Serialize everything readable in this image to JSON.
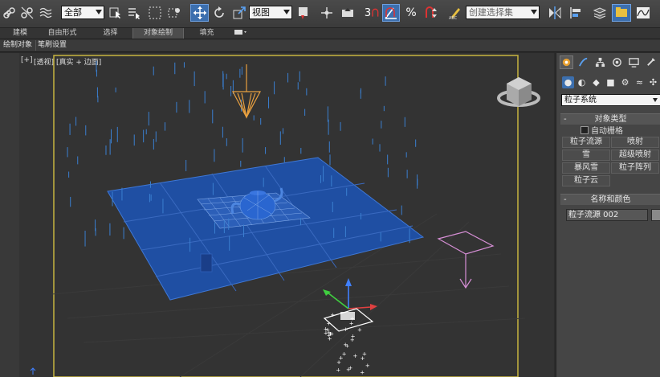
{
  "toolbar": {
    "selection_filter": "全部",
    "reference_coord": "视图",
    "snap_value": "3",
    "named_selection": "创建选择集",
    "colors": {
      "active": "#3c6fae",
      "bg": "#3b3b3b"
    }
  },
  "ribbon": {
    "tabs": [
      "建模",
      "自由形式",
      "选择",
      "对象绘制",
      "填充"
    ],
    "active_tab": "对象绘制",
    "sub_buttons": [
      "绘制对象",
      "笔刷设置"
    ]
  },
  "viewport": {
    "labels": [
      "[+]",
      "[透视]",
      "[真实 + 边面]"
    ],
    "colors": {
      "plane": "#1f4fa3",
      "rain": "#3a7fd0",
      "emitter": "#e8a040",
      "camera": "#d78fd6"
    }
  },
  "command_panel": {
    "tab_icons": [
      "create-icon",
      "modify-icon",
      "hierarchy-icon",
      "motion-icon",
      "display-icon",
      "utilities-icon"
    ],
    "subcategory_icons": [
      "geometry-icon",
      "shapes-icon",
      "lights-icon",
      "cameras-icon",
      "helpers-icon",
      "spacewarps-icon",
      "systems-icon"
    ],
    "category_dropdown": "粒子系统",
    "object_type": {
      "title": "对象类型",
      "auto_grid": "自动栅格",
      "buttons": [
        "粒子流源",
        "喷射",
        "雪",
        "超级喷射",
        "暴风雪",
        "粒子阵列",
        "粒子云"
      ]
    },
    "name_color": {
      "title": "名称和颜色",
      "name_value": "粒子流源 002",
      "swatch_color": "#8a8a8a"
    },
    "minus": "-"
  }
}
